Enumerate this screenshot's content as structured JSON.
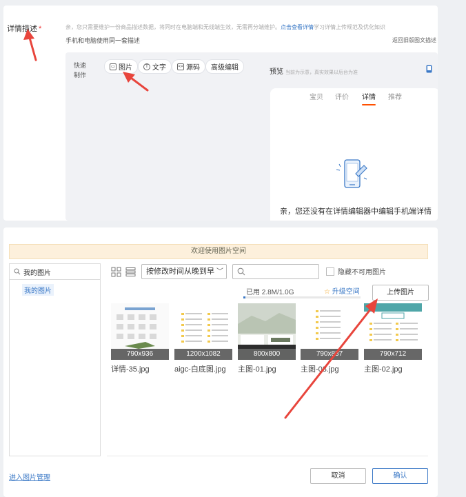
{
  "top": {
    "field_label": "详情描述",
    "required_mark": "*",
    "hint_prefix": "亲，您只需要维护一份商品描述数据，将同时在电脑端和无线端生效，无需再分端维护。",
    "hint_link": "点击查看详情",
    "hint_suffix": "学习详情上传规范及优化知识",
    "sub_label": "手机和电脑使用同一套描述",
    "right_link": "返回旧版图文描述",
    "quick_label": "快速制作",
    "toolbar": {
      "image": "图片",
      "text": "文字",
      "source": "源码",
      "advanced": "高级编辑"
    },
    "preview_label": "预览",
    "preview_note": "当前为示意，真实效果以后台为准",
    "preview_tabs": [
      "宝贝",
      "评价",
      "详情",
      "推荐"
    ],
    "preview_active_tab": "详情",
    "empty_text": "亲，您还没有在详情编辑器中编辑手机端详情"
  },
  "dialog": {
    "banner": "欢迎使用图片空间",
    "left_search_value": "我的图片",
    "left_tree_item": "我的图片",
    "sort_value": "按修改时间从晚到早",
    "search_placeholder": "",
    "hide_unavailable": "隐藏不可用图片",
    "usage": "已用 2.8M/1.0G",
    "usage_fraction": 0.0027,
    "upgrade": "升级空间",
    "upload": "上传图片",
    "images": [
      {
        "dims": "790x936",
        "name": "详情-35.jpg"
      },
      {
        "dims": "1200x1082",
        "name": "aigc-白底图.jpg"
      },
      {
        "dims": "800x800",
        "name": "主图-01.jpg"
      },
      {
        "dims": "790x837",
        "name": "主图-03.jpg"
      },
      {
        "dims": "790x712",
        "name": "主图-02.jpg"
      }
    ],
    "manage_link": "进入图片管理",
    "cancel": "取消",
    "confirm": "确认"
  },
  "colors": {
    "accent": "#3a78c6",
    "annotation_red": "#e8453c",
    "tab_highlight": "#ff5000"
  }
}
